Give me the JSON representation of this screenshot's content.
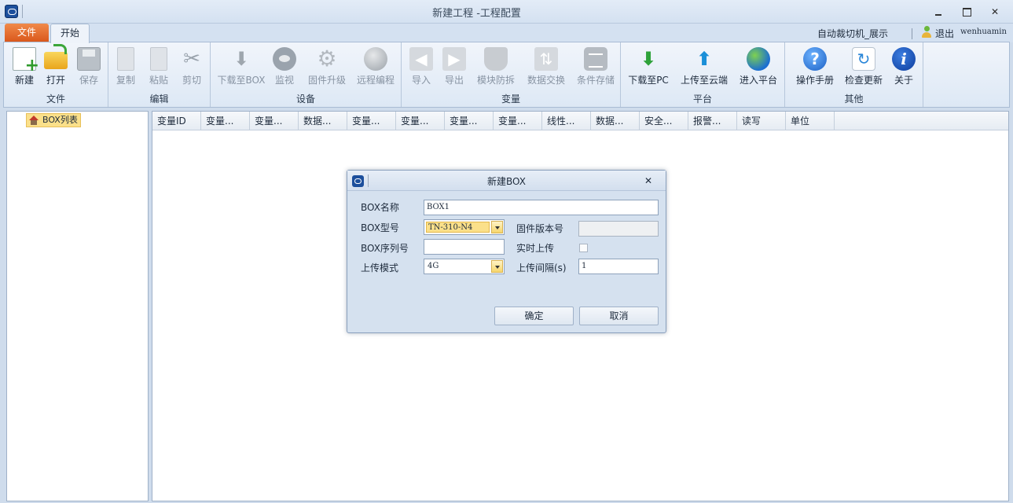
{
  "window": {
    "title": "新建工程 -工程配置",
    "min_icon": "minimize-icon",
    "max_icon": "maximize-icon",
    "close_glyph": "✕"
  },
  "tabs": {
    "file": "文件",
    "home": "开始"
  },
  "user": {
    "project_label": "自动裁切机_展示",
    "logout": "退出",
    "username": "wenhuamin"
  },
  "ribbon": {
    "groups": [
      {
        "label": "文件",
        "buttons": [
          "新建",
          "打开",
          "保存"
        ]
      },
      {
        "label": "编辑",
        "buttons": [
          "复制",
          "粘贴",
          "剪切"
        ]
      },
      {
        "label": "设备",
        "buttons": [
          "下载至BOX",
          "监视",
          "固件升级",
          "远程编程"
        ]
      },
      {
        "label": "变量",
        "buttons": [
          "导入",
          "导出",
          "模块防拆",
          "数据交换",
          "条件存储"
        ]
      },
      {
        "label": "平台",
        "buttons": [
          "下载至PC",
          "上传至云端",
          "进入平台"
        ]
      },
      {
        "label": "其他",
        "buttons": [
          "操作手册",
          "检查更新",
          "关于"
        ]
      }
    ]
  },
  "tree": {
    "root": "BOX列表"
  },
  "grid": {
    "columns": [
      "变量ID",
      "变量...",
      "变量...",
      "数据...",
      "变量...",
      "变量...",
      "变量...",
      "变量...",
      "线性...",
      "数据...",
      "安全...",
      "报警...",
      "读写",
      "单位"
    ]
  },
  "dialog": {
    "title": "新建BOX",
    "close_glyph": "✕",
    "box_name_label": "BOX名称",
    "box_name_value": "BOX1",
    "box_model_label": "BOX型号",
    "box_model_value": "TN-310-N4",
    "firmware_label": "固件版本号",
    "firmware_value": "",
    "serial_label": "BOX序列号",
    "serial_value": "",
    "realtime_label": "实时上传",
    "realtime_checked": false,
    "upload_mode_label": "上传模式",
    "upload_mode_value": "4G",
    "interval_label": "上传间隔(s)",
    "interval_value": "1",
    "ok": "确定",
    "cancel": "取消"
  },
  "colors": {
    "file_tab": "#e0612a",
    "selection": "#fbe08a",
    "ribbon_bg": "#e4edf7"
  }
}
